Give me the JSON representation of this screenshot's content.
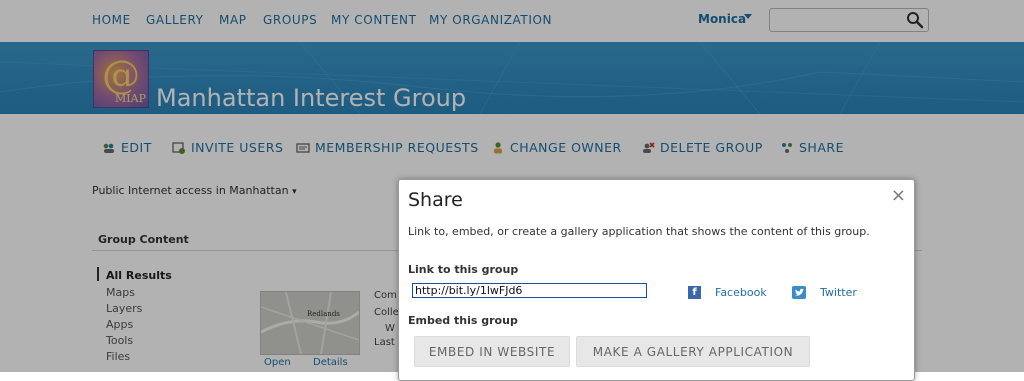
{
  "top_nav": {
    "items": [
      "HOME",
      "GALLERY",
      "MAP",
      "GROUPS",
      "MY CONTENT",
      "MY ORGANIZATION"
    ],
    "user_name": "Monica",
    "search": {
      "value": "",
      "placeholder": ""
    }
  },
  "banner": {
    "logo_text": "MIAP",
    "group_name": "Manhattan Interest Group",
    "color": "#2a84b8"
  },
  "actions": [
    "EDIT",
    "INVITE USERS",
    "MEMBERSHIP REQUESTS",
    "CHANGE OWNER",
    "DELETE GROUP",
    "SHARE"
  ],
  "group_description": "Public Internet access in Manhattan",
  "content": {
    "section_title": "Group Content",
    "filters": [
      "All Results",
      "Maps",
      "Layers",
      "Apps",
      "Tools",
      "Files"
    ],
    "active_filter": "All Results",
    "item": {
      "thumbnail_label": "Redlands",
      "open_label": "Open",
      "details_label": "Details",
      "text_fragments": [
        "Com",
        "Colle",
        "W",
        "Last"
      ]
    }
  },
  "share_dialog": {
    "title": "Share",
    "close_glyph": "×",
    "description": "Link to, embed, or create a gallery application that shows the content of this group.",
    "link_label": "Link to this group",
    "link_value": "http://bit.ly/1lwFJd6",
    "social": [
      {
        "label": "Facebook",
        "icon": "facebook-icon",
        "color": "#3b67a8"
      },
      {
        "label": "Twitter",
        "icon": "twitter-icon",
        "color": "#3b8dc8"
      }
    ],
    "embed_label": "Embed this group",
    "buttons": [
      "EMBED IN WEBSITE",
      "MAKE A GALLERY APPLICATION"
    ]
  }
}
